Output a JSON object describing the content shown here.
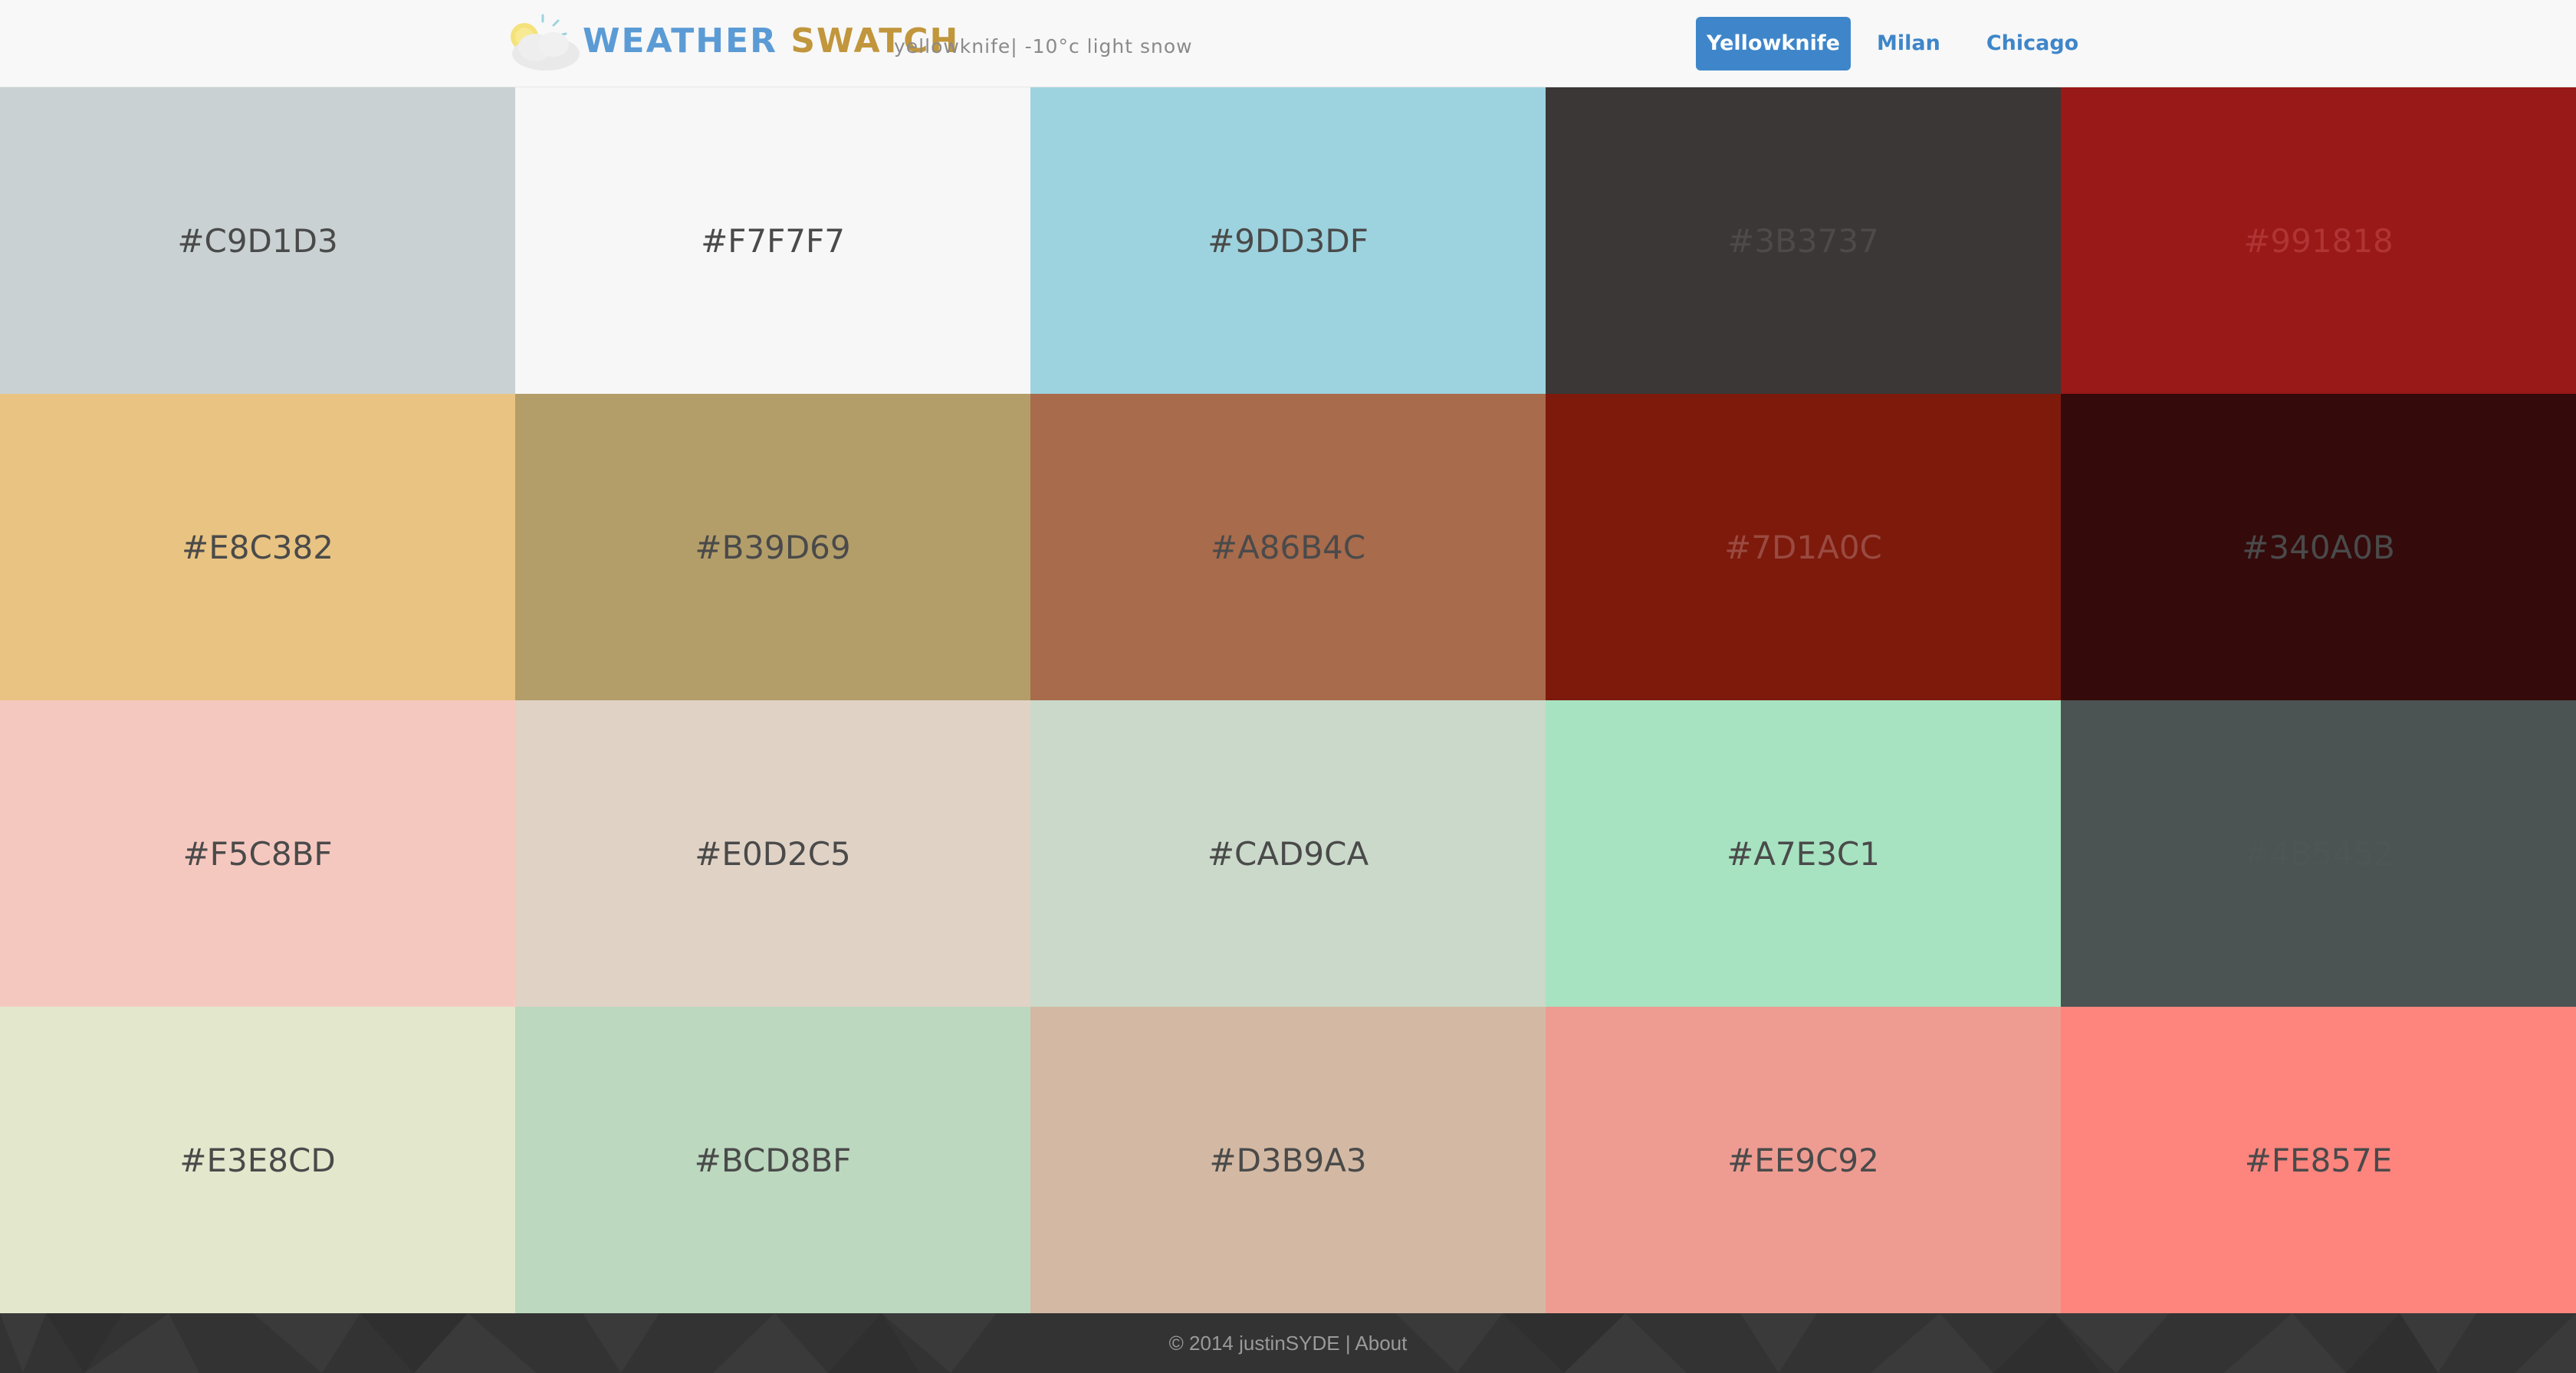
{
  "header": {
    "brand_word1": "WEATHER",
    "brand_word2": "SWATCH",
    "subtitle": "yellowknife| -10°c light snow",
    "logo_icon": "weather-sun-cloud-icon"
  },
  "nav": {
    "items": [
      {
        "label": "Yellowknife",
        "active": true
      },
      {
        "label": "Milan",
        "active": false
      },
      {
        "label": "Chicago",
        "active": false
      }
    ]
  },
  "swatches": [
    {
      "label": "#C9D1D3",
      "color": "#C9D1D3",
      "text_color": "#4a4a4a"
    },
    {
      "label": "#F7F7F7",
      "color": "#F7F7F7",
      "text_color": "#4a4a4a"
    },
    {
      "label": "#9DD3DF",
      "color": "#9DD3DF",
      "text_color": "#4a4a4a"
    },
    {
      "label": "#3B3737",
      "color": "#3B3737",
      "text_color": "#4e4a4a"
    },
    {
      "label": "#991818",
      "color": "#991818",
      "text_color": "#b03434"
    },
    {
      "label": "#E8C382",
      "color": "#E8C382",
      "text_color": "#4a4a4a"
    },
    {
      "label": "#B39D69",
      "color": "#B39D69",
      "text_color": "#4a4a4a"
    },
    {
      "label": "#A86B4C",
      "color": "#A86B4C",
      "text_color": "#4a4a4a"
    },
    {
      "label": "#7D1A0C",
      "color": "#7D1A0C",
      "text_color": "#9a4a40"
    },
    {
      "label": "#340A0B",
      "color": "#340A0B",
      "text_color": "#4a4a4a"
    },
    {
      "label": "#F5C8BF",
      "color": "#F5C8BF",
      "text_color": "#4a4a4a"
    },
    {
      "label": "#E0D2C5",
      "color": "#E0D2C5",
      "text_color": "#4a4a4a"
    },
    {
      "label": "#CAD9CA",
      "color": "#CAD9CA",
      "text_color": "#4a4a4a"
    },
    {
      "label": "#A7E3C1",
      "color": "#A7E3C1",
      "text_color": "#4a4a4a"
    },
    {
      "label": "#4B5452",
      "color": "#4B5452",
      "text_color": "#4e5654"
    },
    {
      "label": "#E3E8CD",
      "color": "#E3E8CD",
      "text_color": "#4a4a4a"
    },
    {
      "label": "#BCD8BF",
      "color": "#BCD8BF",
      "text_color": "#4a4a4a"
    },
    {
      "label": "#D3B9A3",
      "color": "#D3B9A3",
      "text_color": "#4a4a4a"
    },
    {
      "label": "#EE9C92",
      "color": "#EE9C92",
      "text_color": "#4a4a4a"
    },
    {
      "label": "#FE857E",
      "color": "#FE857E",
      "text_color": "#4a4a4a"
    }
  ],
  "footer": {
    "copyright": "© 2014 justinSYDE",
    "separator": "|",
    "about_label": "About"
  }
}
